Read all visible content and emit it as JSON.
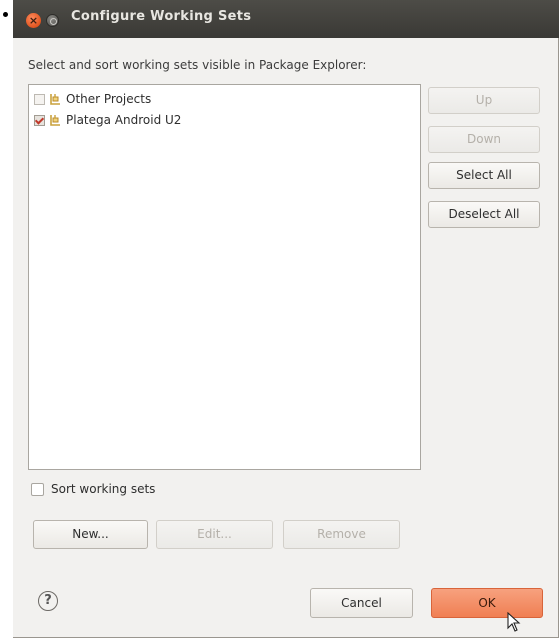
{
  "window": {
    "title": "Configure Working Sets",
    "close_glyph": "×"
  },
  "instruction": "Select and sort working sets visible in Package Explorer:",
  "working_sets": [
    {
      "label": "Other Projects",
      "checked": false
    },
    {
      "label": "Platega Android U2",
      "checked": true
    }
  ],
  "side_buttons": {
    "up": "Up",
    "down": "Down",
    "select_all": "Select All",
    "deselect_all": "Deselect All"
  },
  "sort": {
    "label": "Sort working sets",
    "checked": false
  },
  "action_buttons": {
    "new": "New...",
    "edit": "Edit...",
    "remove": "Remove"
  },
  "footer": {
    "help_glyph": "?",
    "cancel": "Cancel",
    "ok": "OK"
  },
  "colors": {
    "titlebar": "#3f3e3a",
    "close_button": "#e9632d",
    "ok_button": "#f28a62",
    "dialog_bg": "#f2f1ef"
  },
  "icons": {
    "working_set": "working-set-icon",
    "help": "help-icon",
    "close": "close-icon",
    "minimize": "minimize-icon",
    "cursor": "mouse-pointer-icon"
  }
}
